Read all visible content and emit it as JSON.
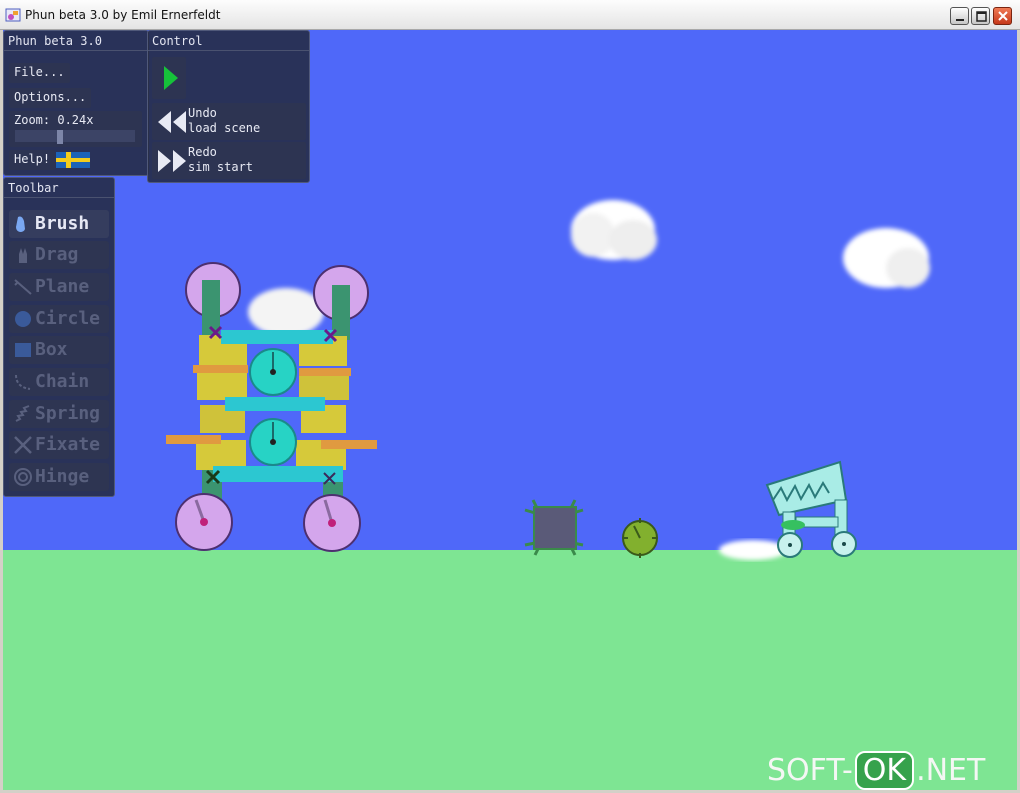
{
  "window": {
    "title": "Phun beta 3.0 by Emil Ernerfeldt",
    "icons": [
      "phun-app-icon",
      "minimize-icon",
      "maximize-icon",
      "close-icon"
    ]
  },
  "main_panel": {
    "title": "Phun beta 3.0",
    "file_label": "File...",
    "options_label": "Options...",
    "zoom_label": "Zoom: 0.24x",
    "zoom_level": 0.24,
    "help_label": "Help!",
    "help_icon": "swedish-flag-icon"
  },
  "control_panel": {
    "title": "Control",
    "play_icon": "play-icon",
    "undo": {
      "line1": "Undo",
      "line2": "load scene",
      "icon": "rewind-icon"
    },
    "redo": {
      "line1": "Redo",
      "line2": "sim start",
      "icon": "fast-forward-icon"
    }
  },
  "toolbar": {
    "title": "Toolbar",
    "tools": [
      {
        "label": "Brush",
        "icon": "brush-icon",
        "active": true
      },
      {
        "label": "Drag",
        "icon": "drag-hand-icon",
        "active": false
      },
      {
        "label": "Plane",
        "icon": "plane-icon",
        "active": false
      },
      {
        "label": "Circle",
        "icon": "circle-icon",
        "active": false
      },
      {
        "label": "Box",
        "icon": "box-icon",
        "active": false
      },
      {
        "label": "Chain",
        "icon": "chain-icon",
        "active": false
      },
      {
        "label": "Spring",
        "icon": "spring-icon",
        "active": false
      },
      {
        "label": "Fixate",
        "icon": "fixate-icon",
        "active": false
      },
      {
        "label": "Hinge",
        "icon": "hinge-icon",
        "active": false
      }
    ]
  },
  "scene": {
    "sky_color": "#4f68f9",
    "ground_color": "#7ee593",
    "objects": [
      "walker-machine",
      "cloud",
      "cloud",
      "cloud",
      "cloud",
      "spiked-box",
      "gear-ball",
      "jaw-vehicle"
    ]
  },
  "watermark": {
    "left": "SOFT-",
    "badge": "OK",
    "right": ".NET"
  }
}
